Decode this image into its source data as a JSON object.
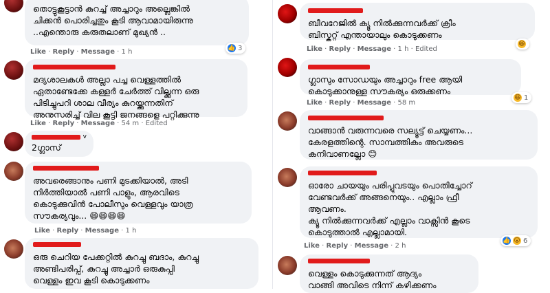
{
  "left": [
    {
      "text": "തൊട്ടുകൂട്ടാൻ കുറച്ച് അച്ചാറും അല്ലെങ്കിൽ\nചിക്കൻ പൊരിച്ചതും കൂടി ആവാമായിരുന്നു\n..എന്തൊരു കരുതലാണ് മുഖ്യൻ ..",
      "actions": [
        "Like",
        "Reply",
        "Message"
      ],
      "time": "1 h",
      "reaction_count": "3",
      "reaction_icon": "like-icon"
    },
    {
      "text": "മദ്യശാലകൾ അല്ലാ പച്ച വെള്ളത്തിൽ\nഏതാണ്ടേക്കേ കള്ളർ ചേർത്ത് വില്ക്കുന്ന ഒരു\nപിടിച്ചുപറി ശാല വീര്യം കുറയ്ക്കുന്നതിന്\nഅനുസരിച്ച് വില കൂട്ടി ജനങ്ങളെ പറ്റിക്കുന്നു",
      "actions": [
        "Like",
        "Reply",
        "Message"
      ],
      "time": "54 m",
      "edited": "Edited"
    },
    {
      "text": "2ഗ്ലാസ്",
      "name_suffix": "v"
    },
    {
      "text": "അവരെങ്ങാനും പണി മുടക്കിയാൽ, അടി\nനിർത്തിയാൽ പണി പാളും, ആരവിടെ\nകൊടുക്കുവിൻ പോലീസും വെള്ളവും യാത്ര\nസൗകര്യവും... 😄😄😄😄",
      "actions": [
        "Like",
        "Reply",
        "Message"
      ],
      "time": "1 h"
    },
    {
      "text": "ഒരു ചെറിയ പേക്കറ്റിൽ കുറച്ചു ബദാം, കുറച്ചു\nഅണ്ടിപരിപ്പ്, കുറച്ചു അച്ചാർ ഒരുകുപ്പി\nവെള്ളം ഇവ കൂടി കൊടുക്കണം"
    }
  ],
  "right": [
    {
      "text": "ബീവറേജിൽ ക്യൂ നിൽക്കുന്നവർക്ക് ക്രീം\nബിസ്കറ്റ് എന്തായാലും കൊടുക്കണം",
      "actions": [
        "Like",
        "Reply",
        "Message"
      ],
      "time": "1 h",
      "edited": "Edited",
      "reaction_count": "",
      "reaction_icon": "haha-icon"
    },
    {
      "text": "ഗ്ലാസും സോഡയും അച്ചാറും free ആയി\nകൊടുക്കാനുള്ള സൗകര്യം ഒരുക്കണം",
      "actions": [
        "Like",
        "Reply",
        "Message"
      ],
      "time": "58 m",
      "reaction_count": "1",
      "reaction_icon": "haha-icon"
    },
    {
      "text": "വാങ്ങാൻ വരുന്നവരെ സല്യൂട്ട് ചെയ്യണം...\nകേരളത്തിന്റെ. സാമ്പത്തികം അവരുടെ\nകനിവാണല്ലോ 😊"
    },
    {
      "text": "ഓരോ ചായയും പരിപ്പുവടയും പൊതിച്ചോറ്\nവേണ്ടവർക്ക് അങ്ങനെയും.. എല്ലാം ഫ്രീ\nആവണം.\nക്യൂ നിൽക്കുന്നവർക്ക് എല്ലാം വാക്സിൻ കൂടെ\nകൊടുത്താൽ എല്ലാമായി.",
      "actions": [
        "Like",
        "Reply",
        "Message"
      ],
      "time": "2 h",
      "reaction_count": "6",
      "reaction_icon": "like-icon"
    },
    {
      "text": "വെള്ളം കൊടുക്കുന്നത് ആദ്യം\nവാങ്ങി അവിടെ നിന്ന് കഴിക്കണം"
    }
  ]
}
